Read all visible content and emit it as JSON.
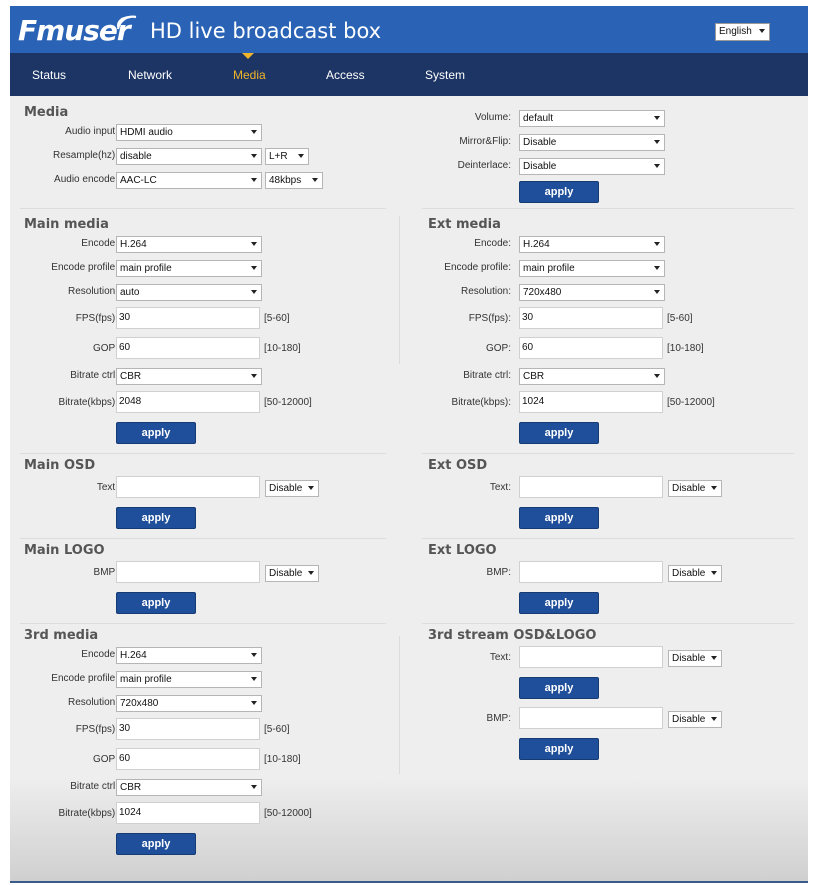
{
  "header": {
    "logo_text": "Fmuser",
    "title": "HD live broadcast box",
    "language": "English"
  },
  "nav": {
    "tabs": [
      {
        "label": "Status"
      },
      {
        "label": "Network"
      },
      {
        "label": "Media"
      },
      {
        "label": "Access"
      },
      {
        "label": "System"
      }
    ],
    "active": "Media"
  },
  "apply_label": "apply",
  "media": {
    "title": "Media",
    "audio_input": {
      "label": "Audio input:",
      "value": "HDMI audio"
    },
    "resample": {
      "label": "Resample(hz):",
      "value": "disable",
      "channel": "L+R"
    },
    "audio_encode": {
      "label": "Audio encode:",
      "value": "AAC-LC",
      "bitrate": "48kbps"
    },
    "volume": {
      "label": "Volume:",
      "value": "default"
    },
    "mirror_flip": {
      "label": "Mirror&Flip:",
      "value": "Disable"
    },
    "deinterlace": {
      "label": "Deinterlace:",
      "value": "Disable"
    }
  },
  "labels": {
    "encode": "Encode:",
    "encode_profile": "Encode profile:",
    "resolution": "Resolution:",
    "fps": "FPS(fps):",
    "gop": "GOP:",
    "bitrate_ctrl": "Bitrate ctrl:",
    "bitrate_kbps": "Bitrate(kbps):",
    "text": "Text:",
    "bmp": "BMP:"
  },
  "ranges": {
    "fps": "[5-60]",
    "gop": "[10-180]",
    "bitrate": "[50-12000]"
  },
  "main_media": {
    "title": "Main media",
    "encode": "H.264",
    "profile": "main profile",
    "resolution": "auto",
    "fps": "30",
    "gop": "60",
    "bitrate_ctrl": "CBR",
    "bitrate": "2048"
  },
  "ext_media": {
    "title": "Ext media",
    "encode": "H.264",
    "profile": "main profile",
    "resolution": "720x480",
    "fps": "30",
    "gop": "60",
    "bitrate_ctrl": "CBR",
    "bitrate": "1024"
  },
  "third_media": {
    "title": "3rd media",
    "encode": "H.264",
    "profile": "main profile",
    "resolution": "720x480",
    "fps": "30",
    "gop": "60",
    "bitrate_ctrl": "CBR",
    "bitrate": "1024"
  },
  "main_osd": {
    "title": "Main OSD",
    "text": "",
    "state": "Disable"
  },
  "ext_osd": {
    "title": "Ext OSD",
    "text": "",
    "state": "Disable"
  },
  "main_logo": {
    "title": "Main LOGO",
    "bmp": "",
    "state": "Disable"
  },
  "ext_logo": {
    "title": "Ext LOGO",
    "bmp": "",
    "state": "Disable"
  },
  "third_osd_logo": {
    "title": "3rd stream OSD&LOGO",
    "text": "",
    "text_state": "Disable",
    "bmp": "",
    "bmp_state": "Disable"
  }
}
